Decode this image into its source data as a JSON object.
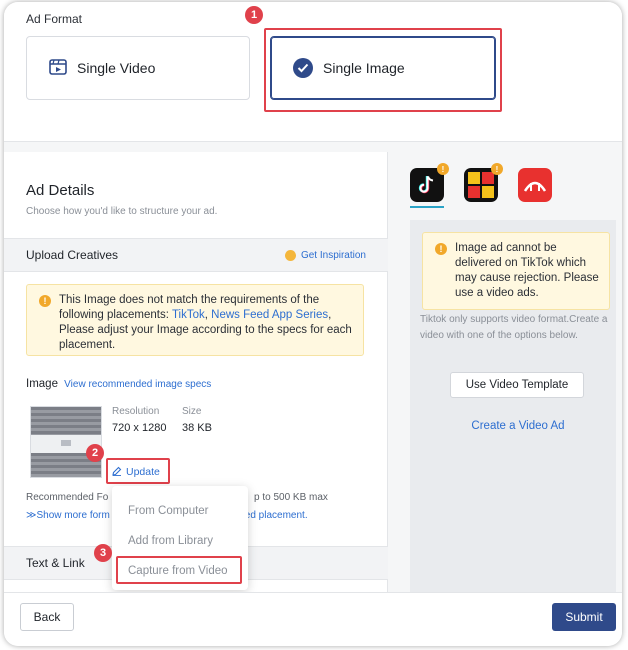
{
  "ad_format": {
    "title": "Ad Format",
    "options": [
      {
        "label": "Single Video",
        "icon": "video-icon",
        "selected": false
      },
      {
        "label": "Single Image",
        "icon": "check-circle-icon",
        "selected": true
      }
    ]
  },
  "steps": [
    "1",
    "2",
    "3"
  ],
  "ad_details": {
    "title": "Ad Details",
    "subtitle": "Choose how you'd like to structure your ad."
  },
  "upload_creatives": {
    "title": "Upload Creatives",
    "inspiration_label": "Get Inspiration",
    "warning": {
      "prefix": "This Image does not match the requirements of the following placements: ",
      "link1": "TikTok",
      "sep": ", ",
      "link2": "News Feed App Series",
      "suffix": ", Please adjust your Image according to the specs for each placement."
    },
    "image_label": "Image",
    "image_specs_link": "View recommended image specs",
    "resolution_label": "Resolution",
    "resolution_value": "720 x 1280",
    "size_label": "Size",
    "size_value": "38 KB",
    "update_label": "Update",
    "recommended_formats": "Recommended Fo",
    "recommended_right": "p to 500 KB max",
    "show_more": "≫Show more form",
    "show_more_right": "ted placement."
  },
  "update_menu": {
    "items": [
      "From Computer",
      "Add from Library",
      "Capture from Video"
    ]
  },
  "text_link": {
    "title": "Text & Link"
  },
  "placements": {
    "icons": [
      "tiktok-icon",
      "news-feed-app-icon",
      "pangle-icon"
    ],
    "warning": "Image ad cannot be delivered on TikTok which may cause rejection. Please use a video ads.",
    "note": "Tiktok only supports video format.Create a video with one of the options below.",
    "template_button": "Use Video Template",
    "create_link": "Create a Video Ad"
  },
  "footer": {
    "back_label": "Back",
    "submit_label": "Submit"
  },
  "colors": {
    "accent": "#2f4a8a",
    "highlight": "#e0414b",
    "link": "#2d6ed0",
    "warning_bg": "#fff8e0"
  }
}
